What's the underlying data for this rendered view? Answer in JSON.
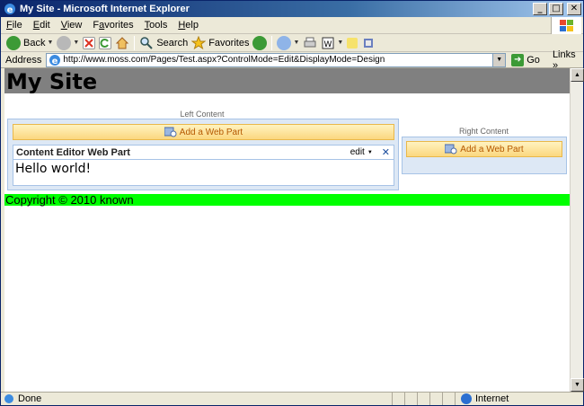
{
  "window": {
    "title": "My Site - Microsoft Internet Explorer",
    "buttons": {
      "minimize": "_",
      "maximize": "□",
      "close": "✕"
    }
  },
  "menu": {
    "items": [
      {
        "label": "File",
        "accel": "F",
        "rest": "ile"
      },
      {
        "label": "Edit",
        "accel": "E",
        "rest": "dit"
      },
      {
        "label": "View",
        "accel": "V",
        "rest": "iew"
      },
      {
        "label": "Favorites",
        "accel": "a",
        "pre": "F",
        "rest": "vorites"
      },
      {
        "label": "Tools",
        "accel": "T",
        "rest": "ools"
      },
      {
        "label": "Help",
        "accel": "H",
        "rest": "elp"
      }
    ]
  },
  "toolbar": {
    "back_label": "Back",
    "search_label": "Search",
    "favorites_label": "Favorites"
  },
  "address": {
    "label": "Address",
    "url": "http://www.moss.com/Pages/Test.aspx?ControlMode=Edit&DisplayMode=Design",
    "go_label": "Go",
    "links_label": "Links",
    "links_chevron": "»"
  },
  "page": {
    "site_title": "My Site",
    "left_zone": {
      "label": "Left Content",
      "add_label": "Add a Web Part"
    },
    "right_zone": {
      "label": "Right Content",
      "add_label": "Add a Web Part"
    },
    "webpart": {
      "title": "Content Editor Web Part",
      "edit_label": "edit",
      "close_glyph": "✕",
      "content": "Hello world!"
    },
    "footer": "Copyright © 2010 known"
  },
  "status": {
    "text": "Done",
    "zone": "Internet"
  },
  "colors": {
    "header_bg": "#808080",
    "footer_bg": "#00ff00",
    "zone_bg": "#dde8f5",
    "addwp_text": "#b55800"
  }
}
